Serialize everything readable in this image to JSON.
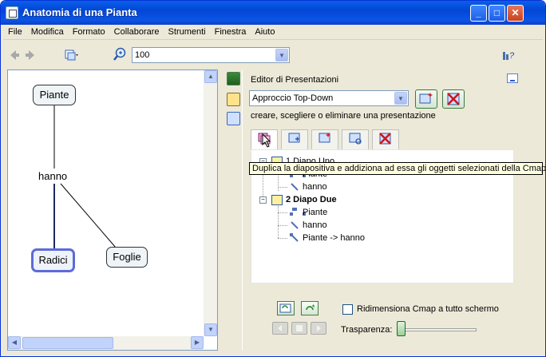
{
  "window": {
    "title": "Anatomia di una Pianta",
    "min": "_",
    "max": "□",
    "close": "✕"
  },
  "menu": [
    "File",
    "Modifica",
    "Formato",
    "Collaborare",
    "Strumenti",
    "Finestra",
    "Aiuto"
  ],
  "toolbar": {
    "zoom_value": "100"
  },
  "concept_map": {
    "nodes": [
      {
        "id": "piante",
        "label": "Piante"
      },
      {
        "id": "radici",
        "label": "Radici"
      },
      {
        "id": "foglie",
        "label": "Foglie"
      }
    ],
    "link_phrase": "hanno"
  },
  "presentation": {
    "panel_title": "Editor di Presentazioni",
    "approach_value": "Approccio Top-Down",
    "hint": "creare, scegliere o eliminare una presentazione",
    "slides": [
      {
        "title": "1 Diapo Uno",
        "items": [
          "Piante",
          "hanno"
        ]
      },
      {
        "title": "2 Diapo Due",
        "items": [
          "Piante",
          "hanno",
          "Piante -> hanno"
        ]
      }
    ],
    "tooltip": "Duplica la diapositiva e addiziona ad essa gli oggetti selezionati della Cmap.",
    "fullscreen_label": "Ridimensiona Cmap a tutto schermo",
    "transparency_label": "Trasparenza:",
    "transparency_value": 0
  },
  "colors": {
    "titlebar": "#0a55e5",
    "node_fill": "#eef4f7",
    "selected_border": "#5d6bd8",
    "accent_green": "#3c7a3c"
  }
}
